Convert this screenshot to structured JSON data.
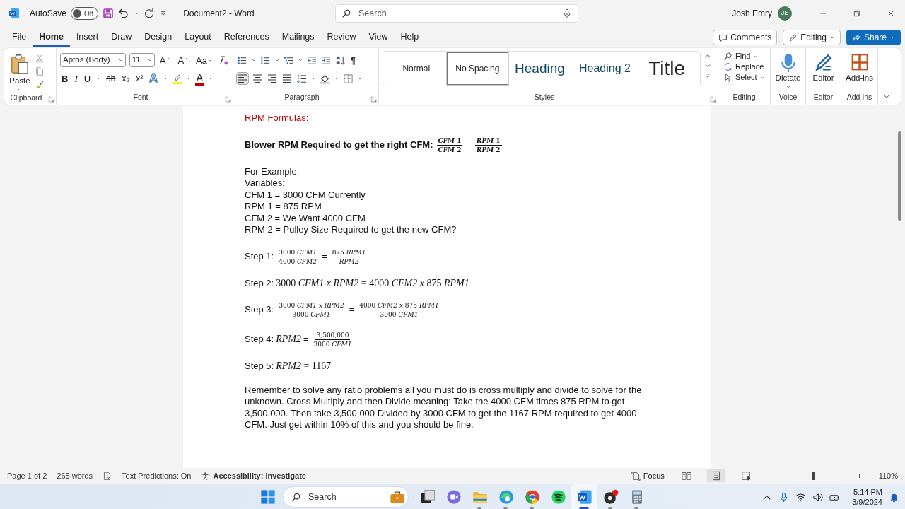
{
  "title_bar": {
    "autosave_label": "AutoSave",
    "autosave": {
      "on": false,
      "label": "Off"
    },
    "document_title": "Document2  -  Word",
    "search": {
      "placeholder": "Search"
    },
    "user_name": "Josh Emry",
    "user_initials": "JE"
  },
  "tabs": [
    {
      "label": "File",
      "selected": false
    },
    {
      "label": "Home",
      "selected": true
    },
    {
      "label": "Insert",
      "selected": false
    },
    {
      "label": "Draw",
      "selected": false
    },
    {
      "label": "Design",
      "selected": false
    },
    {
      "label": "Layout",
      "selected": false
    },
    {
      "label": "References",
      "selected": false
    },
    {
      "label": "Mailings",
      "selected": false
    },
    {
      "label": "Review",
      "selected": false
    },
    {
      "label": "View",
      "selected": false
    },
    {
      "label": "Help",
      "selected": false
    }
  ],
  "ribbon_actions": [
    {
      "kind": "comments",
      "label": "Comments"
    },
    {
      "kind": "editing",
      "label": "Editing"
    },
    {
      "kind": "share",
      "label": "Share"
    }
  ],
  "ribbon": {
    "clipboard": {
      "paste": "Paste",
      "label": "Clipboard"
    },
    "font": {
      "font_name": "Aptos (Body)",
      "font_size": "11",
      "tools": [
        {
          "kind": "grow",
          "label": "A"
        },
        {
          "kind": "shrink",
          "label": "A"
        },
        {
          "kind": "case",
          "label": "Aa"
        }
      ],
      "format": [
        {
          "kind": "bold",
          "label": "B"
        },
        {
          "kind": "italic",
          "label": "I"
        },
        {
          "kind": "underline",
          "label": "U"
        },
        {
          "kind": "strike",
          "label": "ab"
        },
        {
          "kind": "sub",
          "label": "x₂"
        },
        {
          "kind": "sup",
          "label": "x²"
        },
        {
          "kind": "effects",
          "label": "A"
        },
        {
          "kind": "highlight"
        },
        {
          "kind": "color",
          "label": "A"
        }
      ],
      "label": "Font"
    },
    "paragraph": {
      "marks": "¶",
      "alignment": [
        {
          "kind": "left",
          "selected": true
        },
        {
          "kind": "center",
          "selected": false
        },
        {
          "kind": "right",
          "selected": false
        },
        {
          "kind": "justify",
          "selected": false
        }
      ],
      "label": "Paragraph"
    },
    "styles": {
      "items": [
        {
          "kind": "normal",
          "label": "Normal",
          "selected": false
        },
        {
          "kind": "nospacing",
          "label": "No Spacing",
          "selected": true
        },
        {
          "kind": "heading1",
          "label": "Heading",
          "selected": false
        },
        {
          "kind": "heading2",
          "label": "Heading 2",
          "selected": false
        },
        {
          "kind": "title",
          "label": "Title",
          "selected": false
        }
      ],
      "label": "Styles"
    },
    "editing": {
      "items": [
        {
          "kind": "find",
          "label": "Find"
        },
        {
          "kind": "replace",
          "label": "Replace"
        },
        {
          "kind": "select",
          "label": "Select"
        }
      ],
      "label": "Editing"
    },
    "voice": {
      "button": "Dictate",
      "label": "Voice"
    },
    "editor": {
      "button": "Editor",
      "label": "Editor"
    },
    "addins": {
      "button": "Add-ins",
      "label": "Add-ins"
    }
  },
  "document": {
    "sections": [
      [
        {
          "kind": "heading",
          "text": "RPM Formulas:"
        }
      ],
      [
        {
          "kind": "formula",
          "bold": true,
          "label": "Blower RPM Required to get the right CFM:",
          "math": [
            {
              "num": "*CFM* 1",
              "den": "*CFM* 2"
            },
            {
              "op": "="
            },
            {
              "num": "*RPM* 1",
              "den": "*RPM* 2"
            }
          ]
        }
      ],
      [
        {
          "kind": "text",
          "text": "For Example:"
        },
        {
          "kind": "text",
          "text": "Variables:"
        },
        {
          "kind": "text",
          "text": "CFM 1 = 3000 CFM Currently"
        },
        {
          "kind": "text",
          "text": "RPM 1 = 875 RPM"
        },
        {
          "kind": "text",
          "text": "CFM 2 = We Want 4000 CFM"
        },
        {
          "kind": "text",
          "text": "RPM 2 = Pulley Size Required to get the new CFM?"
        }
      ],
      [
        {
          "kind": "formula",
          "label": "Step 1:",
          "math": [
            {
              "num": "3000 *CFM1*",
              "den": "4000 *CFM2*"
            },
            {
              "op": "="
            },
            {
              "num": "875 *RPM1*",
              "den": "*RPM2*"
            }
          ]
        }
      ],
      [
        {
          "kind": "formula",
          "label": "Step 2:",
          "math": [
            {
              "expr": "3000 *CFM1 x RPM2* =  4000 *CFM2 x* 875 *RPM1*"
            }
          ]
        }
      ],
      [
        {
          "kind": "formula",
          "label": "Step 3:",
          "math": [
            {
              "num": "3000 *CFM1 x RPM2*",
              "den": "3000 *CFM1*"
            },
            {
              "op": "="
            },
            {
              "num": "4000 *CFM2 x* 875 *RPM1*",
              "den": "3000 *CFM1*"
            }
          ]
        }
      ],
      [
        {
          "kind": "formula",
          "label": "Step 4:",
          "math": [
            {
              "expr": "*RPM2*"
            },
            {
              "op": "="
            },
            {
              "num": "3,500,000",
              "den": "3000 *CFM1*"
            }
          ]
        }
      ],
      [
        {
          "kind": "formula",
          "label": "Step 5:",
          "math": [
            {
              "expr": "*RPM2* = 1167"
            }
          ]
        }
      ],
      [
        {
          "kind": "text",
          "text": "Remember to solve any ratio problems all you must do is cross multiply and divide to solve for the unknown. Cross Multiply and then Divide meaning: Take the 4000 CFM times 875 RPM to get 3,500,000. Then take 3,500,000 Divided by 3000 CFM to get the 1167 RPM required to get 4000 CFM. Just get within 10% of this and you should be fine."
        }
      ]
    ]
  },
  "status_bar": {
    "page": "Page 1 of 2",
    "words": "265 words",
    "predictions": "Text Predictions: On",
    "accessibility": "Accessibility: Investigate",
    "focus": "Focus",
    "views": [
      {
        "kind": "read",
        "selected": false
      },
      {
        "kind": "print",
        "selected": true
      },
      {
        "kind": "web",
        "selected": false
      }
    ],
    "zoom_minus": "−",
    "zoom_plus": "+",
    "zoom": {
      "level": 0.5,
      "reading": "110%"
    }
  },
  "taskbar": {
    "search": {
      "placeholder": "Search"
    },
    "apps": [
      {
        "kind": "taskview",
        "selected": false,
        "running": false
      },
      {
        "kind": "chat",
        "selected": false,
        "running": false
      },
      {
        "kind": "folder",
        "selected": false,
        "running": true
      },
      {
        "kind": "browser",
        "selected": false,
        "running": true
      },
      {
        "kind": "browser2",
        "selected": false,
        "running": true
      },
      {
        "kind": "music",
        "selected": false,
        "running": false
      },
      {
        "kind": "document",
        "selected": true,
        "running": true
      },
      {
        "kind": "recorder",
        "selected": false,
        "running": true
      },
      {
        "kind": "calculator",
        "selected": false,
        "running": true
      }
    ],
    "time": "5:14 PM",
    "date": "3/9/2024"
  }
}
